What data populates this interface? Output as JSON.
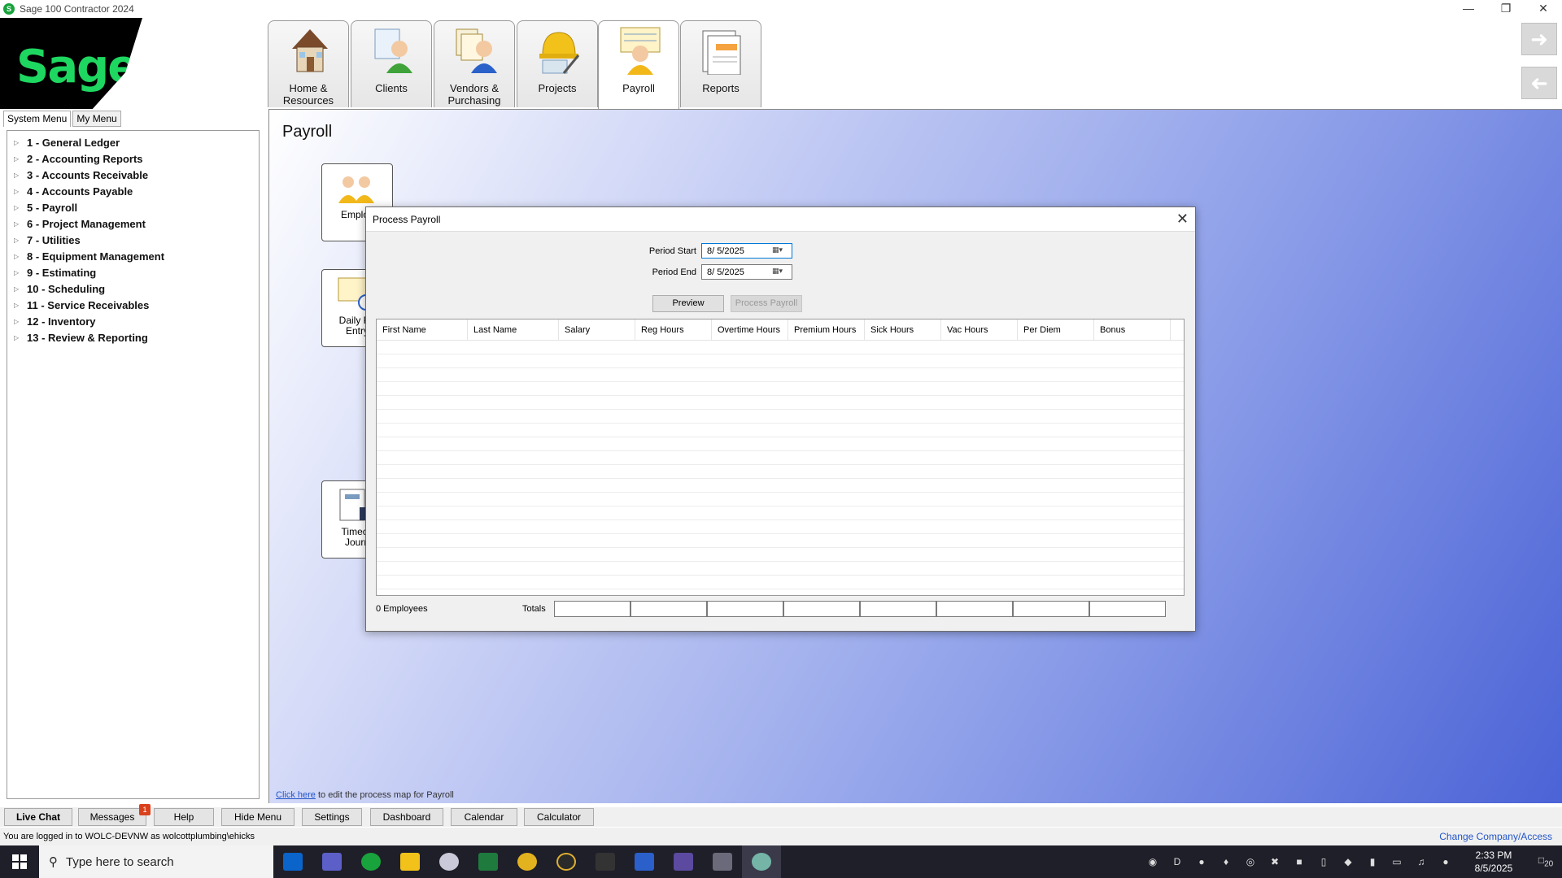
{
  "window": {
    "title": "Sage 100 Contractor 2024",
    "logo": "Sage"
  },
  "tabs": [
    {
      "label_line1": "Home &",
      "label_line2": "Resources",
      "icon": "house-icon"
    },
    {
      "label_line1": "Clients",
      "label_line2": "",
      "icon": "clients-icon"
    },
    {
      "label_line1": "Vendors &",
      "label_line2": "Purchasing",
      "icon": "vendors-icon"
    },
    {
      "label_line1": "Projects",
      "label_line2": "",
      "icon": "hardhat-icon"
    },
    {
      "label_line1": "Payroll",
      "label_line2": "",
      "icon": "payroll-icon"
    },
    {
      "label_line1": "Reports",
      "label_line2": "",
      "icon": "reports-icon"
    }
  ],
  "menu": {
    "tabs": [
      "System Menu",
      "My Menu"
    ],
    "items": [
      "1 - General Ledger",
      "2 - Accounting Reports",
      "3 - Accounts Receivable",
      "4 - Accounts Payable",
      "5 - Payroll",
      "6 - Project Management",
      "7 - Utilities",
      "8 - Equipment Management",
      "9 - Estimating",
      "10 - Scheduling",
      "11 - Service Receivables",
      "12 - Inventory",
      "13 - Review & Reporting"
    ]
  },
  "content": {
    "title": "Payroll",
    "cards": [
      {
        "line1": "Employ",
        "line2": ""
      },
      {
        "line1": "Daily Pa",
        "line2": "Entry"
      },
      {
        "line1": "Timeca",
        "line2": "Journ"
      }
    ],
    "footer_link": "Click here",
    "footer_text": " to edit the process map for Payroll"
  },
  "dialog": {
    "title": "Process Payroll",
    "period_start_label": "Period Start",
    "period_start_value": "8/  5/2025",
    "period_end_label": "Period End",
    "period_end_value": "8/  5/2025",
    "preview_label": "Preview",
    "process_label": "Process Payroll",
    "columns": [
      "First Name",
      "Last Name",
      "Salary",
      "Reg Hours",
      "Overtime Hours",
      "Premium Hours",
      "Sick Hours",
      "Vac Hours",
      "Per Diem",
      "Bonus"
    ],
    "employee_count": "0 Employees",
    "totals_label": "Totals"
  },
  "bottom_buttons": [
    {
      "label": "Live Chat",
      "bold": true
    },
    {
      "label": "Messages",
      "badge": "1"
    },
    {
      "label": "Help"
    },
    {
      "label": "Hide Menu"
    },
    {
      "label": "Settings"
    },
    {
      "label": "Dashboard"
    },
    {
      "label": "Calendar"
    },
    {
      "label": "Calculator"
    }
  ],
  "status": {
    "logged_in": "You are logged in to WOLC-DEVNW as wolcottplumbing\\ehicks",
    "change_company": "Change Company/Access"
  },
  "taskbar": {
    "search_placeholder": "Type here to search",
    "time": "2:33 PM",
    "date": "8/5/2025",
    "notifications": "20"
  }
}
